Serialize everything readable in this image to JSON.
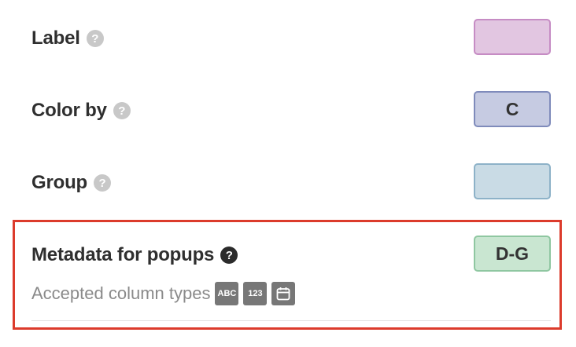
{
  "rows": [
    {
      "label": "Label",
      "column": ""
    },
    {
      "label": "Color by",
      "column": "C"
    },
    {
      "label": "Group",
      "column": ""
    },
    {
      "label": "Metadata for popups",
      "column": "D-G"
    }
  ],
  "help_glyph": "?",
  "accepted": {
    "text": "Accepted column types",
    "types": [
      {
        "name": "text-type-icon",
        "label": "ABC"
      },
      {
        "name": "number-type-icon",
        "label": "123"
      },
      {
        "name": "date-type-icon",
        "label": ""
      }
    ]
  },
  "colors": {
    "highlight_border": "#dc3b2c",
    "label_fill": "#e2c6e1",
    "color_by_fill": "#c6cbe2",
    "group_fill": "#c9dbe5",
    "metadata_fill": "#c9e6d1"
  }
}
